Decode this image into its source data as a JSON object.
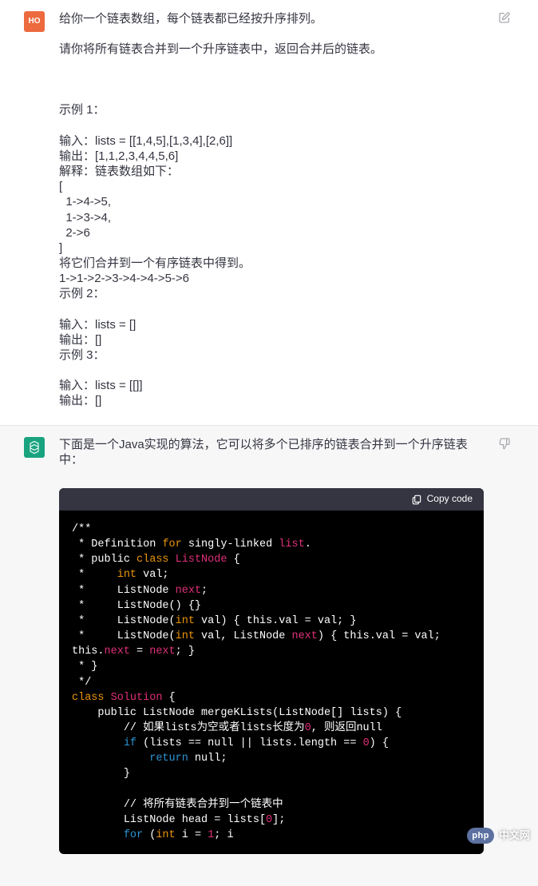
{
  "user": {
    "avatar_text": "HO",
    "lines": [
      "给你一个链表数组，每个链表都已经按升序排列。",
      "",
      "请你将所有链表合并到一个升序链表中，返回合并后的链表。",
      "",
      "",
      "",
      "示例 1：",
      "",
      "输入：lists = [[1,4,5],[1,3,4],[2,6]]",
      "输出：[1,1,2,3,4,4,5,6]",
      "解释：链表数组如下：",
      "[",
      "  1->4->5,",
      "  1->3->4,",
      "  2->6",
      "]",
      "将它们合并到一个有序链表中得到。",
      "1->1->2->3->4->4->5->6",
      "示例 2：",
      "",
      "输入：lists = []",
      "输出：[]",
      "示例 3：",
      "",
      "输入：lists = [[]]",
      "输出：[]"
    ]
  },
  "assistant": {
    "intro": "下面是一个Java实现的算法，它可以将多个已排序的链表合并到一个升序链表中：",
    "copy_label": "Copy code",
    "code": [
      [
        [
          "c",
          "/**"
        ]
      ],
      [
        [
          "c",
          " * Definition "
        ],
        [
          "kf",
          "for"
        ],
        [
          "c",
          " singly-linked "
        ],
        [
          "cl",
          "list"
        ],
        [
          "p",
          "."
        ]
      ],
      [
        [
          "c",
          " * public "
        ],
        [
          "ty",
          "class"
        ],
        [
          "c",
          " "
        ],
        [
          "cl",
          "ListNode"
        ],
        [
          "c",
          " {"
        ]
      ],
      [
        [
          "c",
          " *     "
        ],
        [
          "ty",
          "int"
        ],
        [
          "c",
          " val;"
        ]
      ],
      [
        [
          "c",
          " *     ListNode "
        ],
        [
          "pr",
          "next"
        ],
        [
          "c",
          ";"
        ]
      ],
      [
        [
          "c",
          " *     ListNode() {}"
        ]
      ],
      [
        [
          "c",
          " *     ListNode("
        ],
        [
          "ty",
          "int"
        ],
        [
          "c",
          " val) { this.val = val; }"
        ]
      ],
      [
        [
          "c",
          " *     ListNode("
        ],
        [
          "ty",
          "int"
        ],
        [
          "c",
          " val, ListNode "
        ],
        [
          "pr",
          "next"
        ],
        [
          "c",
          ") { this.val = val; this."
        ],
        [
          "pr",
          "next"
        ],
        [
          "c",
          " = "
        ],
        [
          "pr",
          "next"
        ],
        [
          "c",
          "; }"
        ]
      ],
      [
        [
          "c",
          " * }"
        ]
      ],
      [
        [
          "c",
          " */"
        ]
      ],
      [
        [
          "ty",
          "class"
        ],
        [
          "p",
          " "
        ],
        [
          "cl",
          "Solution"
        ],
        [
          "p",
          " {"
        ]
      ],
      [
        [
          "p",
          "    public ListNode mergeKLists(ListNode[] lists) {"
        ]
      ],
      [
        [
          "p",
          "        // 如果lists为空或者lists长度为"
        ],
        [
          "n",
          "0"
        ],
        [
          "p",
          ", 则返回null"
        ]
      ],
      [
        [
          "p",
          "        "
        ],
        [
          "k",
          "if"
        ],
        [
          "p",
          " (lists == null || lists.length == "
        ],
        [
          "n",
          "0"
        ],
        [
          "p",
          ") {"
        ]
      ],
      [
        [
          "p",
          "            "
        ],
        [
          "k",
          "return"
        ],
        [
          "p",
          " null;"
        ]
      ],
      [
        [
          "p",
          "        }"
        ]
      ],
      [
        [
          "p",
          ""
        ]
      ],
      [
        [
          "p",
          "        // 将所有链表合并到一个链表中"
        ]
      ],
      [
        [
          "p",
          "        ListNode head = lists["
        ],
        [
          "n",
          "0"
        ],
        [
          "p",
          "];"
        ]
      ],
      [
        [
          "p",
          "        "
        ],
        [
          "k",
          "for"
        ],
        [
          "p",
          " ("
        ],
        [
          "ty",
          "int"
        ],
        [
          "p",
          " i = "
        ],
        [
          "n",
          "1"
        ],
        [
          "p",
          "; i"
        ]
      ]
    ]
  },
  "watermark": {
    "badge": "php",
    "text": "中文网"
  }
}
